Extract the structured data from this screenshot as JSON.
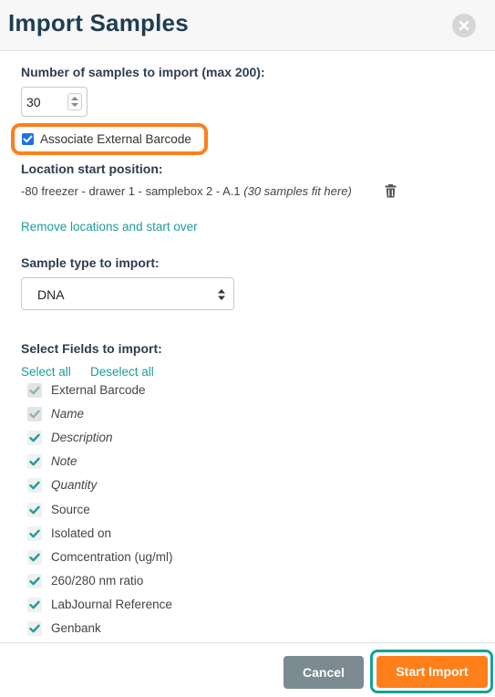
{
  "dialog": {
    "title": "Import Samples"
  },
  "num_samples": {
    "label": "Number of samples to import (max 200):",
    "value": "30"
  },
  "associate_barcode": {
    "label": "Associate External Barcode",
    "checked": true
  },
  "location": {
    "label": "Location start position:",
    "freezer": "-80 freezer",
    "drawer": "drawer 1",
    "box": "samplebox 2",
    "position": "A.1",
    "fit_note": "(30 samples fit here)",
    "separator": " - ",
    "remove_link": "Remove locations and start over"
  },
  "sample_type": {
    "label": "Sample type to import:",
    "selected": "DNA"
  },
  "fields": {
    "label": "Select Fields to import:",
    "select_all": "Select all",
    "deselect_all": "Deselect all",
    "items": [
      {
        "label": "External Barcode",
        "checked": true,
        "disabled": true,
        "italic": false
      },
      {
        "label": "Name",
        "checked": true,
        "disabled": true,
        "italic": true
      },
      {
        "label": "Description",
        "checked": true,
        "disabled": false,
        "italic": true
      },
      {
        "label": "Note",
        "checked": true,
        "disabled": false,
        "italic": true
      },
      {
        "label": "Quantity",
        "checked": true,
        "disabled": false,
        "italic": true
      },
      {
        "label": "Source",
        "checked": true,
        "disabled": false,
        "italic": false
      },
      {
        "label": "Isolated on",
        "checked": true,
        "disabled": false,
        "italic": false
      },
      {
        "label": "Comcentration (ug/ml)",
        "checked": true,
        "disabled": false,
        "italic": false
      },
      {
        "label": "260/280 nm ratio",
        "checked": true,
        "disabled": false,
        "italic": false
      },
      {
        "label": "LabJournal Reference",
        "checked": true,
        "disabled": false,
        "italic": false
      },
      {
        "label": "Genbank",
        "checked": true,
        "disabled": false,
        "italic": false
      }
    ]
  },
  "footer": {
    "cancel": "Cancel",
    "start": "Start Import"
  },
  "colors": {
    "accent_teal": "#1e9c9a",
    "highlight_orange": "#ff7f1a",
    "title_navy": "#1f3d52"
  },
  "icons": [
    "close-icon",
    "trash-icon",
    "checkbox-icon",
    "select-arrows-icon"
  ]
}
